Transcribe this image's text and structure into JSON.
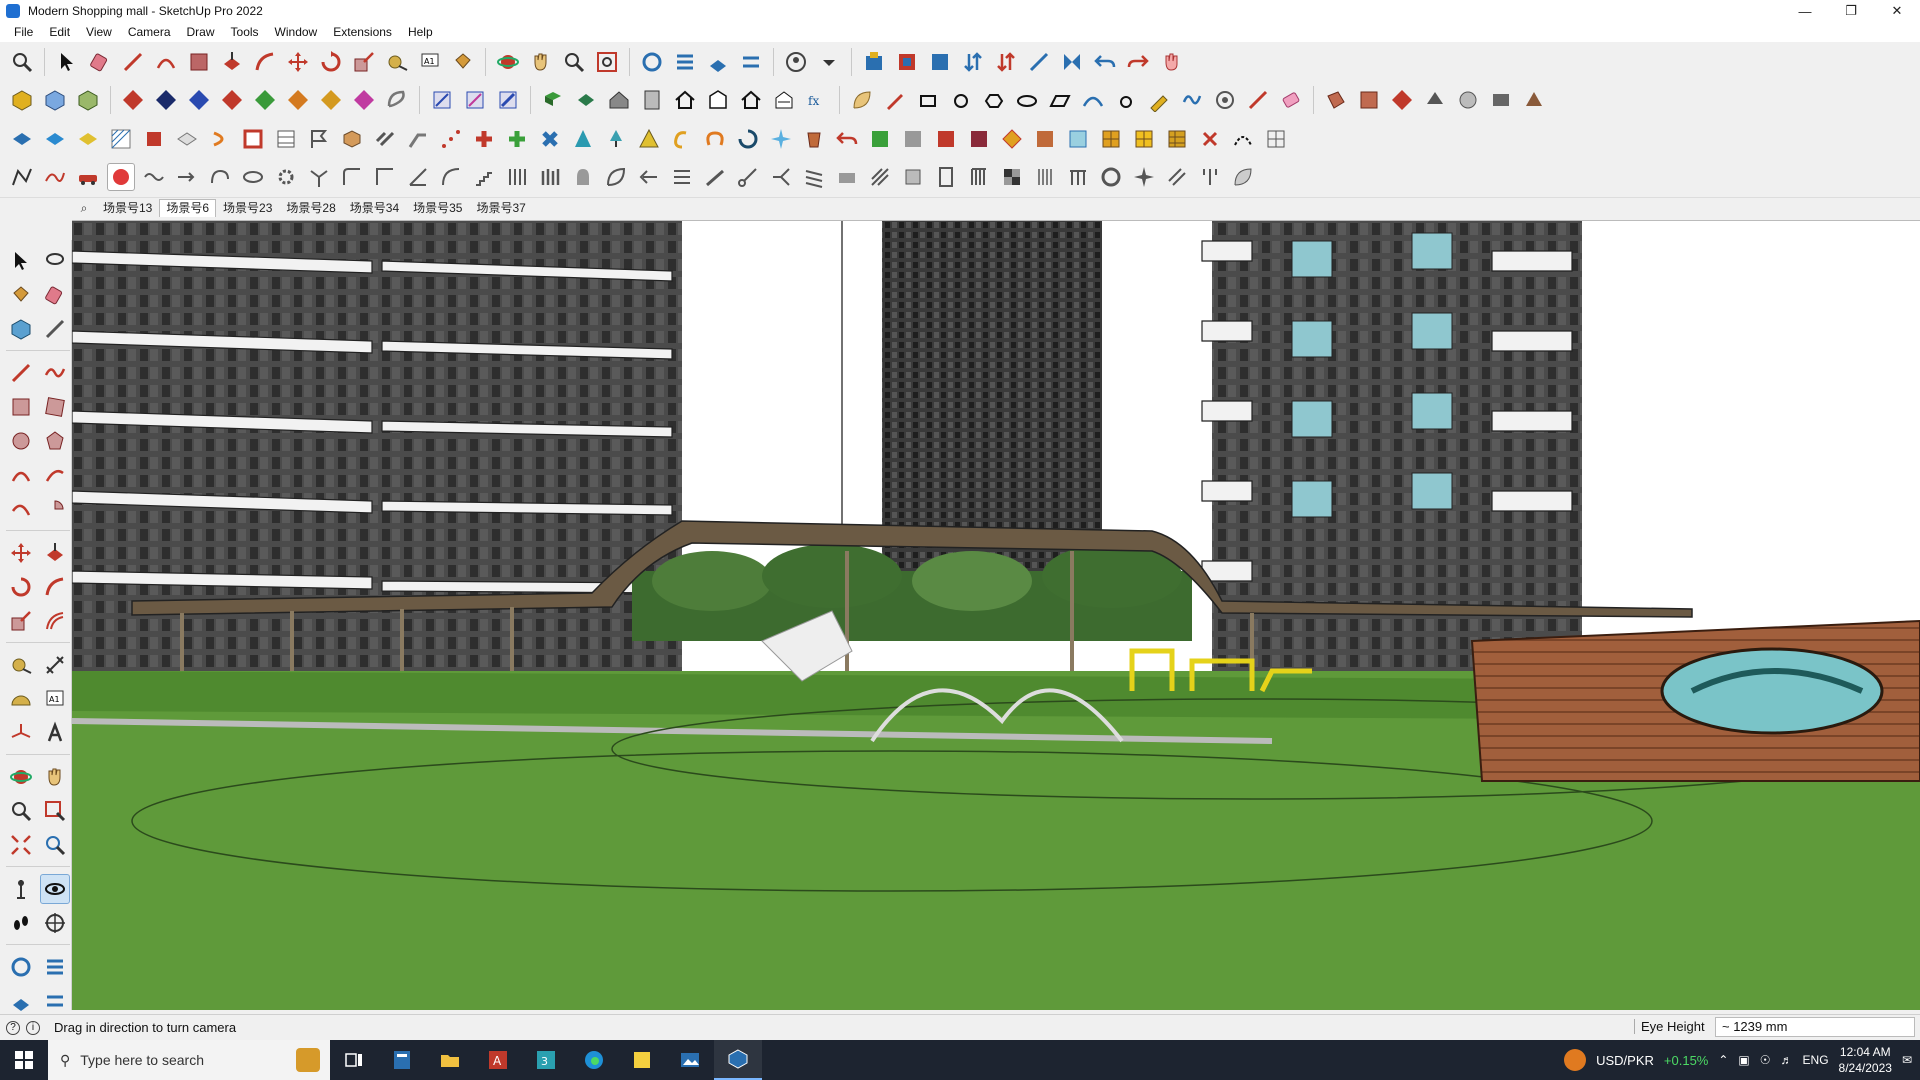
{
  "window": {
    "title": "Modern Shopping mall - SketchUp Pro 2022"
  },
  "menu": [
    "File",
    "Edit",
    "View",
    "Camera",
    "Draw",
    "Tools",
    "Window",
    "Extensions",
    "Help"
  ],
  "scenes": {
    "tabs": [
      "场景号13",
      "场景号6",
      "场景号23",
      "场景号28",
      "场景号34",
      "场景号35",
      "场景号37"
    ],
    "active_index": 1
  },
  "status": {
    "hint": "Drag in direction to turn camera",
    "measure_label": "Eye Height",
    "measure_value": "~ 1239 mm"
  },
  "taskbar": {
    "search_placeholder": "Type here to search",
    "ticker_symbol": "USD/PKR",
    "ticker_change": "+0.15%",
    "language": "ENG",
    "time": "12:04 AM",
    "date": "8/24/2023"
  },
  "colors": {
    "sky": "#ffffff",
    "grass": "#5f9a3a",
    "building": "#4b4b4b",
    "canopy": "#6b5a44",
    "wall": "#a15f3c"
  }
}
